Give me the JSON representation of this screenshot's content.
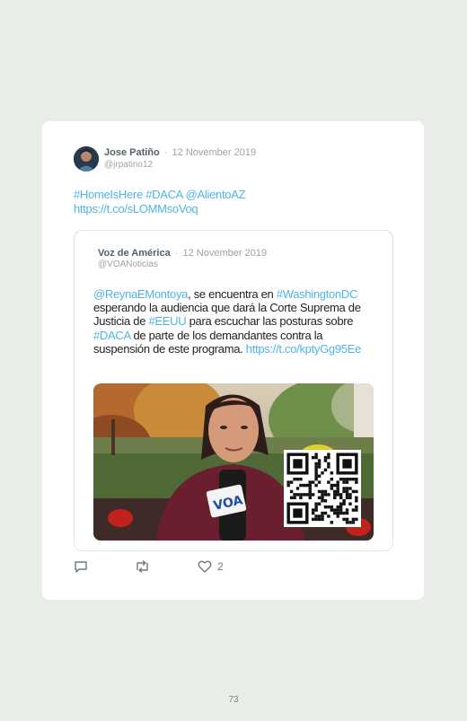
{
  "tweet": {
    "author_name": "Jose Patiño",
    "separator": "·",
    "date": "12 November 2019",
    "handle": "@jrpatino12",
    "text_line1": "#HomeIsHere #DACA @AlientoAZ",
    "text_line2": "https://t.co/sLOMMsoVoq",
    "like_count": "2"
  },
  "quoted_tweet": {
    "author_name": "Voz de América",
    "separator": "·",
    "date": "12 November 2019",
    "handle": "@VOANoticias",
    "body": [
      {
        "text": "@ReynaEMontoya",
        "link": true
      },
      {
        "text": ", se encuentra en ",
        "link": false
      },
      {
        "text": "#WashingtonDC",
        "link": true
      },
      {
        "text": " esperando la audiencia que dará la Corte Suprema de Justicia de ",
        "link": false
      },
      {
        "text": "#EEUU",
        "link": true
      },
      {
        "text": " para escuchar las posturas sobre ",
        "link": false
      },
      {
        "text": "#DACA",
        "link": true
      },
      {
        "text": " de parte de los demandantes contra la suspensión de este programa. ",
        "link": false
      },
      {
        "text": "https://t.co/kptyGg95Ee",
        "link": true
      }
    ],
    "mic_logo": "VOA"
  },
  "icons": {
    "reply": "reply-icon",
    "retweet": "retweet-icon",
    "like": "heart-icon"
  },
  "page": {
    "number": "73"
  }
}
